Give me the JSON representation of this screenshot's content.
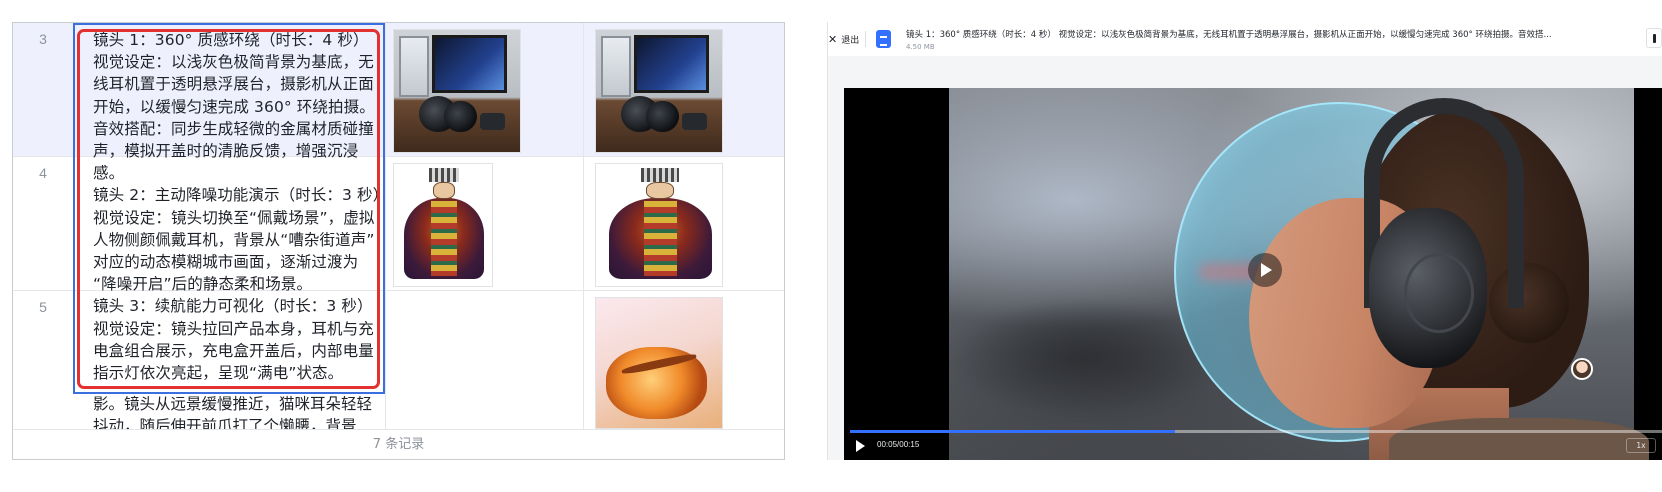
{
  "table": {
    "rows": [
      {
        "num": "3"
      },
      {
        "num": "4"
      },
      {
        "num": "5"
      }
    ],
    "content_lines": [
      "镜头 1：360° 质感环绕（时长：4 秒）",
      "视觉设定：以浅灰色极简背景为基底，无",
      "线耳机置于透明悬浮展台，摄影机从正面",
      "开始，以缓慢匀速完成 360° 环绕拍摄。",
      "音效搭配：同步生成轻微的金属材质碰撞",
      "声，模拟开盖时的清脆反馈，增强沉浸",
      "感。",
      "镜头 2：主动降噪功能演示（时长：3 秒）",
      "视觉设定：镜头切换至“佩戴场景”，虚拟",
      "人物侧颜佩戴耳机，背景从“嘈杂街道声”",
      "对应的动态模糊城市画面，逐渐过渡为",
      "“降噪开启”后的静态柔和场景。",
      "镜头 3：续航能力可视化（时长：3 秒）",
      "视觉设定：镜头拉回产品本身，耳机与充",
      "电盒组合展示，充电盒开盖后，内部电量",
      "指示灯依次亮起，呈现“满电”状态。"
    ],
    "tail_lines": [
      "影。镜头从远景缓慢推近，猫咪耳朵轻轻",
      "抖动，随后伸开前爪打了个懒腰，背景..."
    ],
    "footer": "7 条记录"
  },
  "viewer": {
    "exit_label": "退出",
    "file_title": "镜头 1：360° 质感环绕（时长：4 秒） 视觉设定：以浅灰色极简背景为基底，无线耳机置于透明悬浮展台，摄影机从正面开始，以缓慢匀速完成 360° 环绕拍摄。音效搭...",
    "file_size": "4.50 MB",
    "time": "00:05/00:15",
    "speed": "1x",
    "progress": 0.4,
    "accent": "#3370ff"
  },
  "icons": [
    "close-icon",
    "file-icon",
    "play-icon",
    "more-icon",
    "avatar"
  ]
}
